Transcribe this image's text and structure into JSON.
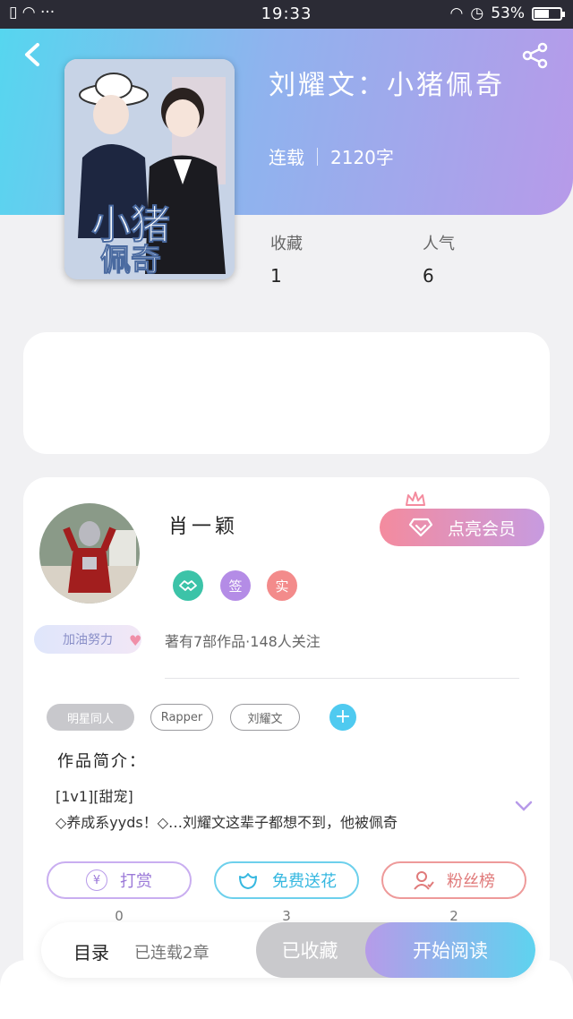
{
  "status_bar": {
    "time": "19:33",
    "battery": "53%",
    "left_icons": "▯ ◠ ···"
  },
  "book": {
    "title": "刘耀文：小猪佩奇",
    "status": "连载",
    "word_count": "2120字",
    "stats": [
      {
        "label": "收藏",
        "value": "1"
      },
      {
        "label": "人气",
        "value": "6"
      }
    ]
  },
  "author": {
    "name": "肖一颖",
    "vip_button": "点亮会员",
    "badges": [
      {
        "icon": "handshake-icon",
        "text": "",
        "color": "#3cc3a8"
      },
      {
        "icon": "sign-icon",
        "text": "签",
        "color": "#b48ce6"
      },
      {
        "icon": "real-icon",
        "text": "实",
        "color": "#f38b8b"
      }
    ],
    "pill_label": "加油努力",
    "works_line": "著有7部作品·148人关注"
  },
  "tags": [
    "明星同人",
    "Rapper",
    "刘耀文"
  ],
  "intro": {
    "heading": "作品简介：",
    "line1": "[1v1][甜宠]",
    "line2": "◇养成系yyds！◇…刘耀文这辈子都想不到，他被佩奇"
  },
  "actions": [
    {
      "label": "打赏",
      "icon": "yen-icon",
      "count": "0",
      "color": "#b79ae9"
    },
    {
      "label": "免费送花",
      "icon": "flower-icon",
      "count": "3",
      "color": "#5cc9e6"
    },
    {
      "label": "粉丝榜",
      "icon": "fan-icon",
      "count": "2",
      "color": "#ee8f8f"
    }
  ],
  "bottom_bar": {
    "catalog": "目录",
    "chapters": "已连载2章",
    "collected": "已收藏",
    "read": "开始阅读"
  },
  "colors": {
    "accent_blue": "#56d6ef",
    "accent_purple": "#b79ae9",
    "vip_pink": "#f48b9e"
  }
}
